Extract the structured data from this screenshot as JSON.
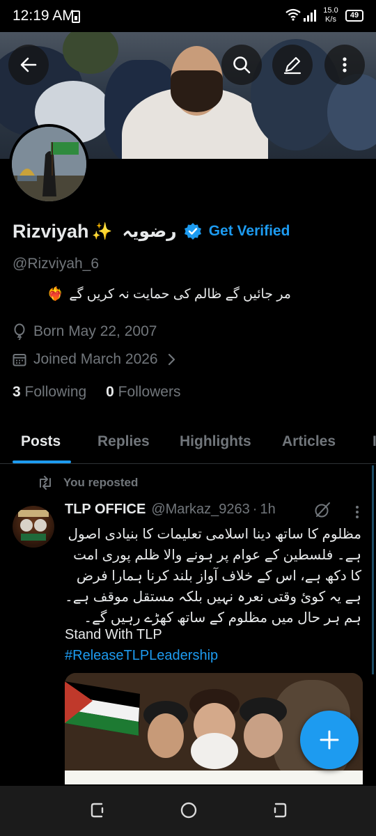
{
  "status_bar": {
    "time": "12:19 AM",
    "speed_value": "15.0",
    "speed_unit": "K/s",
    "battery": "49"
  },
  "header_icons": [
    "back-arrow-icon",
    "search-icon",
    "compose-icon",
    "more-vertical-icon"
  ],
  "profile": {
    "display_name": "Rizviyah",
    "sparkle": "✨",
    "urdu_name": "رضویہ",
    "get_verified": "Get Verified",
    "handle": "@Rizviyah_6",
    "bio": "مر جائیں گے ظالم کی حمایت نہ کریں گے",
    "bio_emoji": "❤️‍🔥",
    "born": "Born May 22, 2007",
    "joined": "Joined March 2026",
    "following_count": "3",
    "following_label": "Following",
    "followers_count": "0",
    "followers_label": "Followers"
  },
  "tabs": [
    {
      "label": "Posts",
      "active": true
    },
    {
      "label": "Replies",
      "active": false
    },
    {
      "label": "Highlights",
      "active": false
    },
    {
      "label": "Articles",
      "active": false
    },
    {
      "label": "I",
      "active": false
    }
  ],
  "tweet": {
    "repost_label": "You reposted",
    "author": "TLP OFFICE",
    "handle": "@Markaz_9263",
    "separator": "·",
    "time": "1h",
    "body_urdu": "مظلوم کا ساتھ دینا اسلامی تعلیمات کا بنیادی اصول ہے۔ فلسطین کے عوام پر ہونے والا ظلم پوری امت کا دکھ ہے، اس کے خلاف آواز بلند کرنا ہمارا فرض ہے یہ کوئ وقتی نعرہ نہیں بلکہ مستقل موقف ہے۔ ہم ہر حال میں مظلوم کے ساتھ کھڑے رہیں گے۔",
    "body_english": "Stand With TLP",
    "hashtag": "#ReleaseTLPLeadership"
  },
  "colors": {
    "accent": "#1d9bf0",
    "muted": "#71767b",
    "text": "#e7e9ea",
    "background": "#000000"
  }
}
